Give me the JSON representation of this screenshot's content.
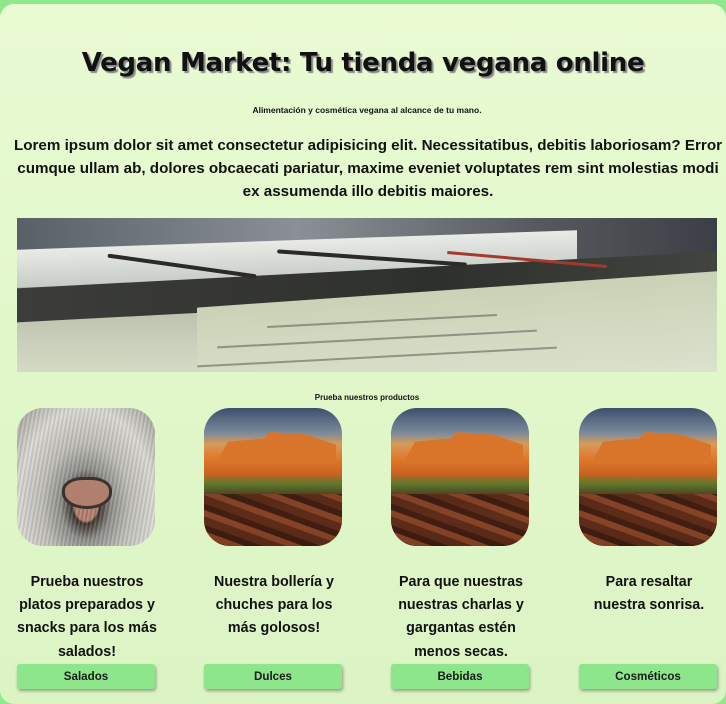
{
  "header": {
    "title": "Vegan Market: Tu tienda vegana online",
    "subtitle": "Alimentación y cosmética vegana al alcance de tu mano."
  },
  "intro": "Lorem ipsum dolor sit amet consectetur adipisicing elit. Necessitatibus, debitis laboriosam? Error cumque ullam ab, dolores obcaecati pariatur, maxime eveniet voluptates rem sint molestias modi ex assumenda illo debitis maiores.",
  "products": {
    "section_label": "Prueba nuestros productos",
    "items": [
      {
        "image": "cat-nose",
        "text": "Prueba nuestros platos preparados y snacks para los más salados!",
        "button": "Salados"
      },
      {
        "image": "canyon",
        "text": "Nuestra bollería y chuches para los más golosos!",
        "button": "Dulces"
      },
      {
        "image": "canyon",
        "text": "Para que nuestras nuestras charlas y gargantas estén menos secas.",
        "button": "Bebidas"
      },
      {
        "image": "canyon",
        "text": "Para resaltar nuestra sonrisa.",
        "button": "Cosméticos"
      }
    ]
  },
  "colors": {
    "top_bar": "#8fe88c",
    "background": "#e2f8cb",
    "button": "#8ee68c"
  }
}
